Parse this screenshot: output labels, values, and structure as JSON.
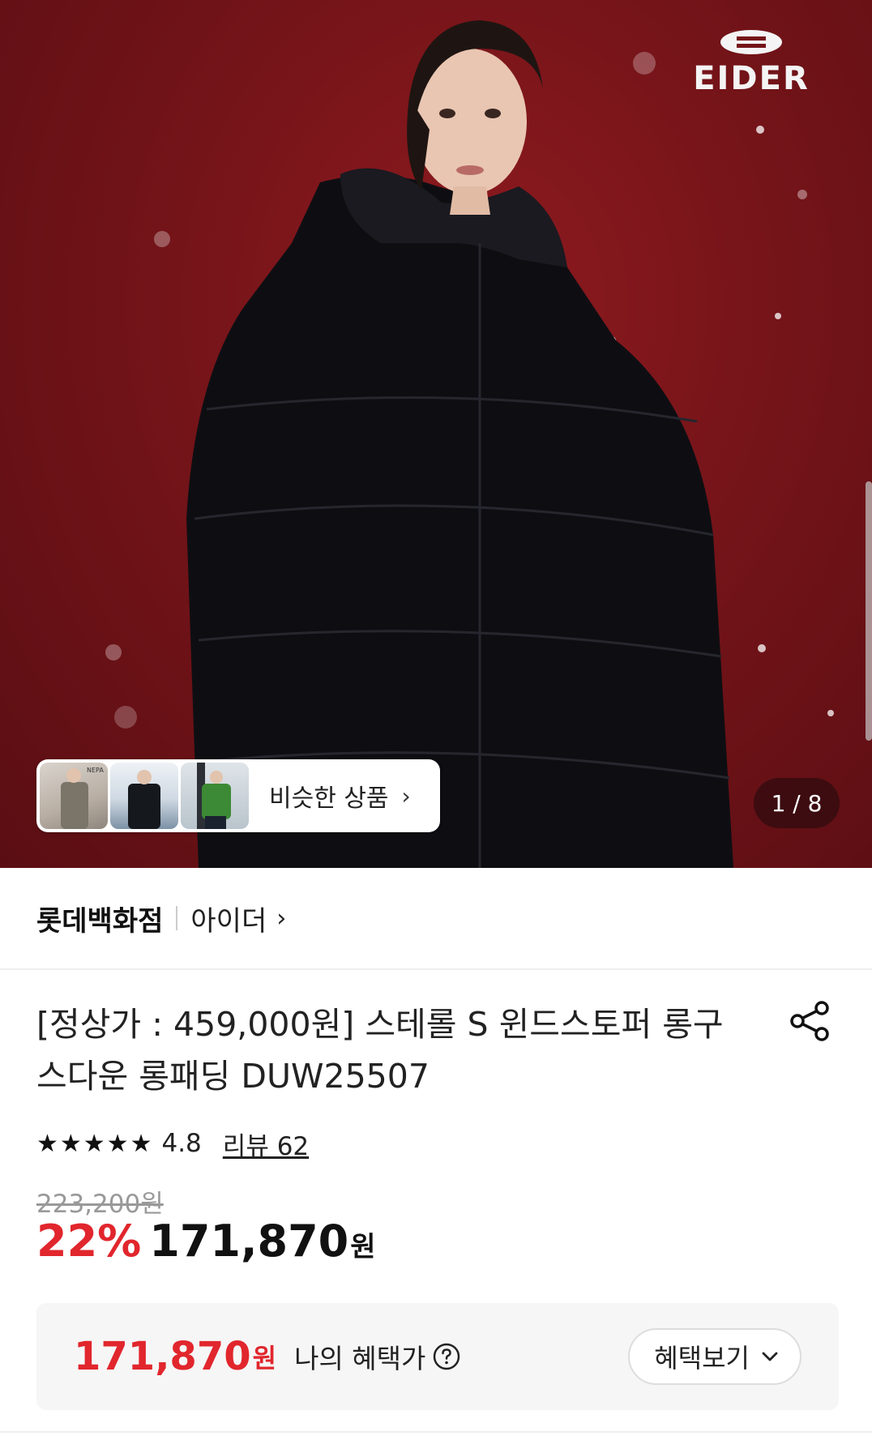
{
  "hero": {
    "brand_logo_text": "EIDER",
    "similar_products_label": "비슷한 상품",
    "similar_products_thumbs": [
      "NEPA",
      "",
      ""
    ],
    "pager_text": "1 / 8"
  },
  "store": {
    "name": "롯데백화점",
    "brand": "아이더"
  },
  "product": {
    "title": "[정상가 : 459,000원] 스테롤 S 윈드스토퍼 롱구스다운 롱패딩 DUW25507",
    "rating": "4.8",
    "review_link": "리뷰 62",
    "original_price": "223,200원",
    "discount": "22%",
    "sale_price": "171,870",
    "currency": "원"
  },
  "benefit": {
    "price": "171,870",
    "currency": "원",
    "label": "나의 혜택가",
    "button_label": "혜택보기"
  },
  "colors": {
    "accent_red": "#e1262d",
    "hero_background": "#741419"
  }
}
